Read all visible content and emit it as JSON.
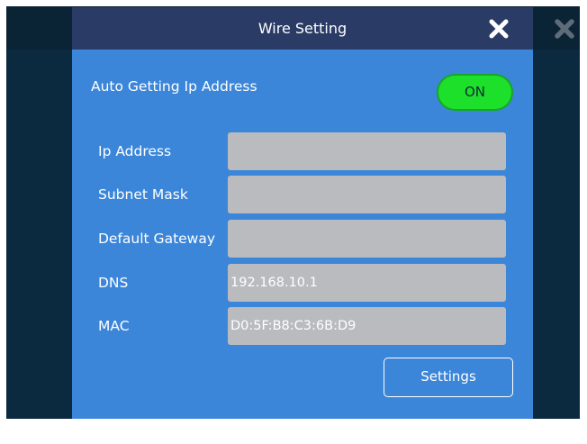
{
  "dialog": {
    "title": "Wire Setting",
    "close_icon": "close-x-icon"
  },
  "background": {
    "close_icon": "close-x-icon"
  },
  "auto_ip": {
    "label": "Auto Getting Ip Address",
    "toggle_state": "ON"
  },
  "fields": [
    {
      "label": "Ip Address",
      "value": ""
    },
    {
      "label": "Subnet Mask",
      "value": ""
    },
    {
      "label": "Default Gateway",
      "value": ""
    },
    {
      "label": "DNS",
      "value": "192.168.10.1"
    },
    {
      "label": "MAC",
      "value": "D0:5F:B8:C3:6B:D9"
    }
  ],
  "settings_button": {
    "label": "Settings"
  },
  "colors": {
    "background": "#0c2a3f",
    "dialog_body": "#3b86d9",
    "dialog_header": "#2a3c66",
    "toggle_on": "#1de02a",
    "input_field": "#b9bbbf",
    "text": "#ffffff"
  }
}
